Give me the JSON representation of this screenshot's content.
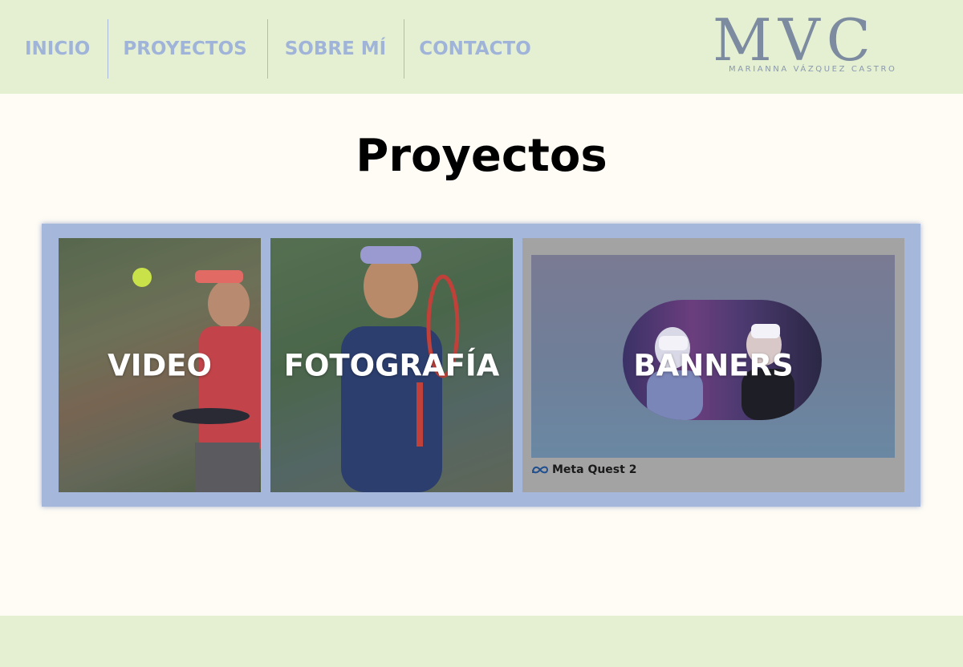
{
  "nav": {
    "items": [
      {
        "label": "INICIO"
      },
      {
        "label": "PROYECTOS"
      },
      {
        "label": "SOBRE MÍ"
      },
      {
        "label": "CONTACTO"
      }
    ]
  },
  "logo": {
    "mark": "MVC",
    "subtitle": "MARIANNA VÁZQUEZ CASTRO"
  },
  "page": {
    "title": "Proyectos"
  },
  "projects": [
    {
      "label": "VIDEO"
    },
    {
      "label": "FOTOGRAFÍA"
    },
    {
      "label": "BANNERS",
      "caption": "Meta Quest 2"
    }
  ],
  "colors": {
    "header_bg": "#e5f0d3",
    "nav_text": "#9fb4d8",
    "page_bg": "#fffcf5",
    "gallery_bg": "#a5b8dc"
  }
}
